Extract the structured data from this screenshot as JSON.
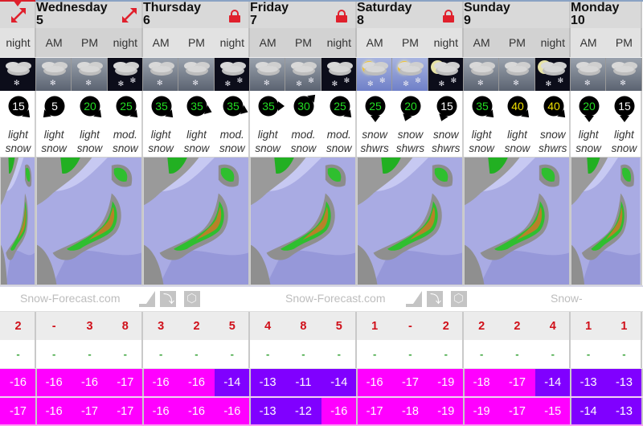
{
  "site": {
    "brand": "Snow-Forecast.com"
  },
  "colors": {
    "accent_red": "#e0202c",
    "snow_text": "#d0101a",
    "rain_text": "#3aa43a",
    "temp_magenta": "#ff00ff",
    "temp_violet": "#8000ff",
    "wind_green": "#22dd22",
    "wind_yellow": "#f0e000",
    "wind_white": "#ffffff"
  },
  "days": [
    {
      "key": "prev",
      "name": "",
      "number": "",
      "locked": false,
      "expand_icon": true,
      "periods": [
        "night"
      ]
    },
    {
      "key": "wed",
      "name": "Wednesday",
      "number": "5",
      "locked": false,
      "expand_icon": true,
      "periods": [
        "AM",
        "PM",
        "night"
      ]
    },
    {
      "key": "thu",
      "name": "Thursday",
      "number": "6",
      "locked": true,
      "expand_icon": false,
      "periods": [
        "AM",
        "PM",
        "night"
      ]
    },
    {
      "key": "fri",
      "name": "Friday",
      "number": "7",
      "locked": true,
      "expand_icon": false,
      "periods": [
        "AM",
        "PM",
        "night"
      ]
    },
    {
      "key": "sat",
      "name": "Saturday",
      "number": "8",
      "locked": true,
      "expand_icon": false,
      "periods": [
        "AM",
        "PM",
        "night"
      ]
    },
    {
      "key": "sun",
      "name": "Sunday",
      "number": "9",
      "locked": false,
      "expand_icon": false,
      "periods": [
        "AM",
        "PM",
        "night"
      ]
    },
    {
      "key": "mon",
      "name": "Monday",
      "number": "10",
      "locked": false,
      "expand_icon": false,
      "periods": [
        "AM",
        "PM"
      ]
    }
  ],
  "slots": [
    {
      "period": "night",
      "weather_icon": "cloudy-light-snow-night",
      "wind": {
        "speed": "15",
        "color": "white",
        "direction": "from-NW"
      },
      "summary": [
        "light",
        "snow"
      ],
      "snow_cm": "2",
      "rain_mm": "-",
      "temp_max": "-16",
      "temp_min": "-17"
    },
    {
      "period": "AM",
      "weather_icon": "cloudy-light-snow-day",
      "wind": {
        "speed": "5",
        "color": "white",
        "direction": "from-NE"
      },
      "summary": [
        "light",
        "snow"
      ],
      "snow_cm": "-",
      "rain_mm": "-",
      "temp_max": "-16",
      "temp_min": "-16"
    },
    {
      "period": "PM",
      "weather_icon": "cloudy-light-snow-day",
      "wind": {
        "speed": "20",
        "color": "green",
        "direction": "from-NW"
      },
      "summary": [
        "light",
        "snow"
      ],
      "snow_cm": "3",
      "rain_mm": "-",
      "temp_max": "-16",
      "temp_min": "-17"
    },
    {
      "period": "night",
      "weather_icon": "cloudy-mod-snow-night",
      "wind": {
        "speed": "25",
        "color": "green",
        "direction": "from-NW"
      },
      "summary": [
        "mod.",
        "snow"
      ],
      "snow_cm": "8",
      "rain_mm": "-",
      "temp_max": "-17",
      "temp_min": "-17"
    },
    {
      "period": "AM",
      "weather_icon": "cloudy-light-snow-day",
      "wind": {
        "speed": "35",
        "color": "green",
        "direction": "from-NW"
      },
      "summary": [
        "light",
        "snow"
      ],
      "snow_cm": "3",
      "rain_mm": "-",
      "temp_max": "-16",
      "temp_min": "-16"
    },
    {
      "period": "PM",
      "weather_icon": "cloudy-light-snow-day",
      "wind": {
        "speed": "35",
        "color": "green",
        "direction": "from-WNW"
      },
      "summary": [
        "light",
        "snow"
      ],
      "snow_cm": "2",
      "rain_mm": "-",
      "temp_max": "-16",
      "temp_min": "-16"
    },
    {
      "period": "night",
      "weather_icon": "cloudy-mod-snow-night",
      "wind": {
        "speed": "35",
        "color": "green",
        "direction": "from-WNW"
      },
      "summary": [
        "mod.",
        "snow"
      ],
      "snow_cm": "5",
      "rain_mm": "-",
      "temp_max": "-14",
      "temp_min": "-16"
    },
    {
      "period": "AM",
      "weather_icon": "cloudy-light-snow-day",
      "wind": {
        "speed": "35",
        "color": "green",
        "direction": "from-W"
      },
      "summary": [
        "light",
        "snow"
      ],
      "snow_cm": "4",
      "rain_mm": "-",
      "temp_max": "-13",
      "temp_min": "-13"
    },
    {
      "period": "PM",
      "weather_icon": "cloudy-mod-snow-day",
      "wind": {
        "speed": "30",
        "color": "green",
        "direction": "from-SW"
      },
      "summary": [
        "mod.",
        "snow"
      ],
      "snow_cm": "8",
      "rain_mm": "-",
      "temp_max": "-11",
      "temp_min": "-12"
    },
    {
      "period": "night",
      "weather_icon": "cloudy-mod-snow-night",
      "wind": {
        "speed": "25",
        "color": "green",
        "direction": "from-NW"
      },
      "summary": [
        "mod.",
        "snow"
      ],
      "snow_cm": "5",
      "rain_mm": "-",
      "temp_max": "-14",
      "temp_min": "-16"
    },
    {
      "period": "AM",
      "weather_icon": "sun-cloud-snow-showers",
      "wind": {
        "speed": "25",
        "color": "green",
        "direction": "from-N"
      },
      "summary": [
        "snow",
        "shwrs"
      ],
      "snow_cm": "1",
      "rain_mm": "-",
      "temp_max": "-16",
      "temp_min": "-17"
    },
    {
      "period": "PM",
      "weather_icon": "sun-cloud-snow-showers",
      "wind": {
        "speed": "20",
        "color": "green",
        "direction": "from-NNE"
      },
      "summary": [
        "snow",
        "shwrs"
      ],
      "snow_cm": "-",
      "rain_mm": "-",
      "temp_max": "-17",
      "temp_min": "-18"
    },
    {
      "period": "night",
      "weather_icon": "moon-cloud-snow-showers",
      "wind": {
        "speed": "15",
        "color": "white",
        "direction": "from-NNE"
      },
      "summary": [
        "snow",
        "shwrs"
      ],
      "snow_cm": "2",
      "rain_mm": "-",
      "temp_max": "-19",
      "temp_min": "-19"
    },
    {
      "period": "AM",
      "weather_icon": "cloudy-light-snow-day",
      "wind": {
        "speed": "35",
        "color": "green",
        "direction": "from-NW"
      },
      "summary": [
        "light",
        "snow"
      ],
      "snow_cm": "2",
      "rain_mm": "-",
      "temp_max": "-18",
      "temp_min": "-19"
    },
    {
      "period": "PM",
      "weather_icon": "cloudy-light-snow-day",
      "wind": {
        "speed": "40",
        "color": "yellow",
        "direction": "from-NW"
      },
      "summary": [
        "light",
        "snow"
      ],
      "snow_cm": "2",
      "rain_mm": "-",
      "temp_max": "-17",
      "temp_min": "-17"
    },
    {
      "period": "night",
      "weather_icon": "moon-cloud-snow-showers",
      "wind": {
        "speed": "40",
        "color": "yellow",
        "direction": "from-NW"
      },
      "summary": [
        "snow",
        "shwrs"
      ],
      "snow_cm": "4",
      "rain_mm": "-",
      "temp_max": "-14",
      "temp_min": "-15"
    },
    {
      "period": "AM",
      "weather_icon": "cloudy-light-snow-day",
      "wind": {
        "speed": "20",
        "color": "green",
        "direction": "from-N"
      },
      "summary": [
        "light",
        "snow"
      ],
      "snow_cm": "1",
      "rain_mm": "-",
      "temp_max": "-13",
      "temp_min": "-14"
    },
    {
      "period": "PM",
      "weather_icon": "cloudy-light-snow-day",
      "wind": {
        "speed": "15",
        "color": "white",
        "direction": "from-N"
      },
      "summary": [
        "light",
        "snow"
      ],
      "snow_cm": "1",
      "rain_mm": "-",
      "temp_max": "-13",
      "temp_min": "-13"
    }
  ],
  "maps": [
    {
      "label": "snow-map-prev"
    },
    {
      "label": "snow-map-wed"
    },
    {
      "label": "snow-map-thu"
    },
    {
      "label": "snow-map-fri"
    },
    {
      "label": "snow-map-sat"
    },
    {
      "label": "snow-map-sun"
    },
    {
      "label": "snow-map-mon"
    }
  ],
  "brand_icons": [
    "map-layer-icon",
    "map-arrow-icon",
    "map-snowflake-icon"
  ]
}
